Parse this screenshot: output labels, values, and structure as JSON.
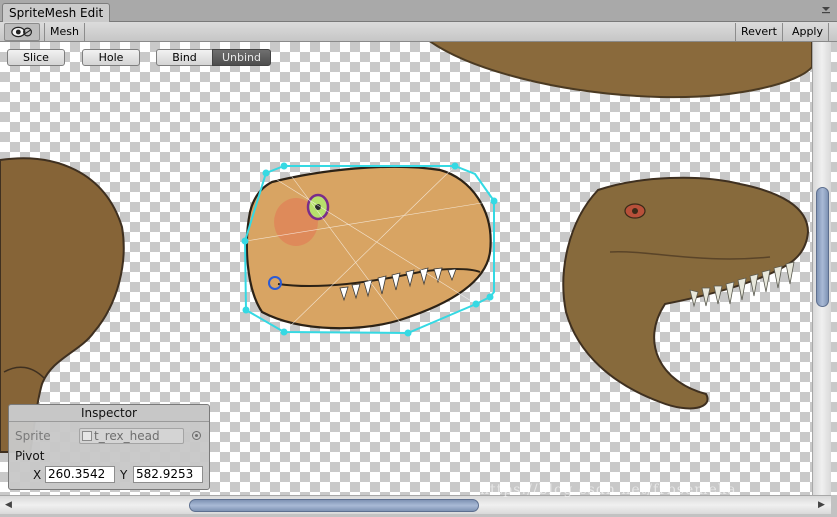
{
  "window": {
    "tab_title": "SpriteMesh Edit"
  },
  "toolbar": {
    "mode_label": "Mesh",
    "revert_label": "Revert",
    "apply_label": "Apply"
  },
  "mode_buttons": {
    "slice": "Slice",
    "hole": "Hole",
    "bind": "Bind",
    "unbind": "Unbind"
  },
  "inspector": {
    "title": "Inspector",
    "sprite_label": "Sprite",
    "sprite_value": "t_rex_head",
    "pivot_label": "Pivot",
    "x_label": "X",
    "x_value": "260.3542",
    "y_label": "Y",
    "y_value": "582.9253"
  },
  "watermark": "https://blog.csdn.net/frbsemeka",
  "colors": {
    "selection_outline": "#35d9e3",
    "unbind_active": "#5a5a5a",
    "scroll_thumb": "#90a4c6"
  }
}
